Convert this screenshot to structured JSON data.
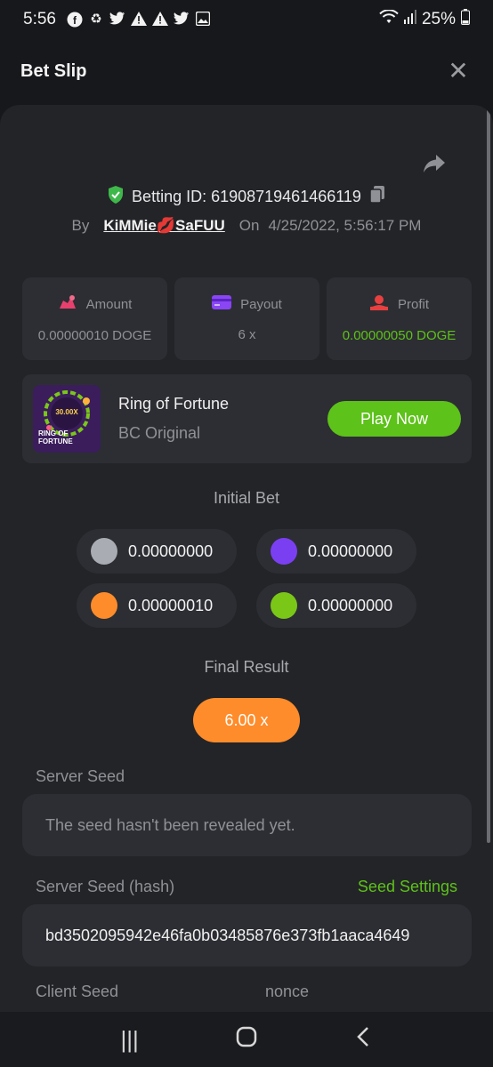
{
  "status_bar": {
    "time": "5:56",
    "battery": "25%",
    "left_icons": [
      "facebook-icon",
      "recycle-icon",
      "twitter-icon",
      "warning-icon",
      "warning-icon",
      "twitter-icon",
      "image-icon"
    ],
    "right_icons": [
      "wifi-icon",
      "signal-icon",
      "battery-icon"
    ]
  },
  "header": {
    "title": "Bet Slip",
    "close_glyph": "✕"
  },
  "bet": {
    "id_label": "Betting ID: 61908719461466119",
    "by_label": "By",
    "user": "KiMMie💋SaFUU",
    "on_label": "On",
    "datetime": "4/25/2022, 5:56:17 PM"
  },
  "stats": [
    {
      "label": "Amount",
      "value": "0.00000010 DOGE",
      "icon": "amount-icon",
      "icon_color": "#e8406e"
    },
    {
      "label": "Payout",
      "value": "6 x",
      "icon": "payout-icon",
      "icon_color": "#8a45f5"
    },
    {
      "label": "Profit",
      "value": "0.00000050 DOGE",
      "icon": "profit-icon",
      "icon_color": "#e84040"
    }
  ],
  "game": {
    "name": "Ring of Fortune",
    "provider": "BC Original",
    "play_label": "Play Now",
    "thumb_text_top": "30.00X",
    "thumb_text_bottom": "RING OF FORTUNE"
  },
  "initial_bet": {
    "title": "Initial Bet",
    "chips": [
      {
        "color": "#a9adb3",
        "value": "0.00000000"
      },
      {
        "color": "#7b3ff2",
        "value": "0.00000000"
      },
      {
        "color": "#ff8c2a",
        "value": "0.00000010"
      },
      {
        "color": "#7ac718",
        "value": "0.00000000"
      }
    ]
  },
  "final_result": {
    "title": "Final Result",
    "value": "6.00 x"
  },
  "server_seed": {
    "label": "Server Seed",
    "value": "The seed hasn't been revealed yet."
  },
  "server_seed_hash": {
    "label": "Server Seed (hash)",
    "settings_label": "Seed Settings",
    "value": "bd3502095942e46fa0b03485876e373fb1aaca4649"
  },
  "client_seed": {
    "label": "Client Seed",
    "nonce_label": "nonce"
  },
  "nav": {
    "recents": "|||",
    "home": "○",
    "back": "‹"
  },
  "colors": {
    "accent_green": "#5dc219",
    "accent_orange": "#ff8c2a",
    "panel": "#232428",
    "card": "#2d2e33"
  }
}
